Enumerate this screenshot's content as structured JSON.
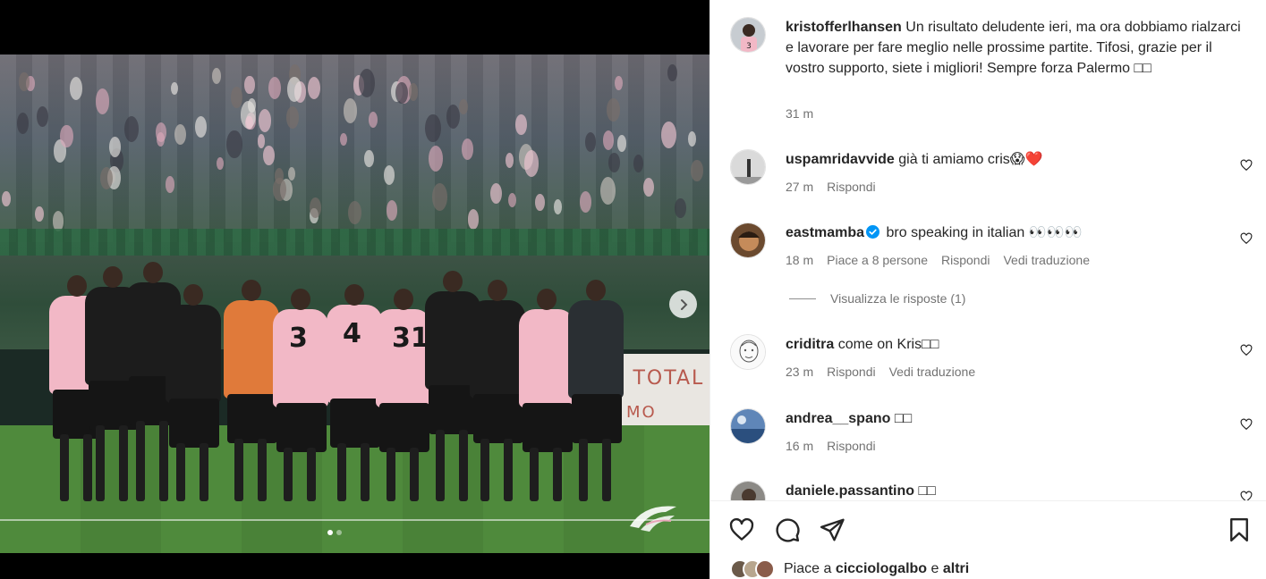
{
  "post": {
    "author": "kristofferlhansen",
    "caption": "Un risultato deludente ieri, ma ora dobbiamo rialzarci e lavorare per fare meglio nelle prossime partite. Tifosi, grazie per il vostro supporto, siete i migliori! Sempre forza Palermo □□",
    "time": "31 m"
  },
  "media": {
    "board_text_top": "I TOTAL",
    "board_text_bottom": "MO",
    "slide_count": 2,
    "active_slide": 1,
    "jersey_numbers": [
      "3",
      "4",
      "31"
    ]
  },
  "comments": [
    {
      "user": "uspamridavvide",
      "text": "già ti amiamo cris😱❤️",
      "time": "27 m",
      "likes": "",
      "reply_label": "Rispondi",
      "translate": "",
      "verified": false
    },
    {
      "user": "eastmamba",
      "text": "bro speaking in italian 👀👀👀",
      "time": "18 m",
      "likes": "Piace a 8 persone",
      "reply_label": "Rispondi",
      "translate": "Vedi traduzione",
      "verified": true
    },
    {
      "user": "criditra",
      "text": "come on Kris□□",
      "time": "23 m",
      "likes": "",
      "reply_label": "Rispondi",
      "translate": "Vedi traduzione",
      "verified": false
    },
    {
      "user": "andrea__spano",
      "text": "□□",
      "time": "16 m",
      "likes": "",
      "reply_label": "Rispondi",
      "translate": "",
      "verified": false
    },
    {
      "user": "daniele.passantino",
      "text": "□□",
      "time": "",
      "likes": "",
      "reply_label": "",
      "translate": "",
      "verified": false
    }
  ],
  "view_replies": "Visualizza le risposte (1)",
  "likes_summary": {
    "prefix": "Piace a ",
    "user": "cicciologalbo",
    "middle": " e ",
    "others": "altri"
  },
  "icons": {
    "like": "heart-icon",
    "comment": "comment-icon",
    "share": "send-icon",
    "save": "bookmark-icon",
    "next": "chevron-right-icon"
  },
  "colors": {
    "heart_red": "#ed4956",
    "verified_blue": "#0095f6",
    "muted_text": "#737373",
    "jersey_pink": "#f2b8c6"
  }
}
